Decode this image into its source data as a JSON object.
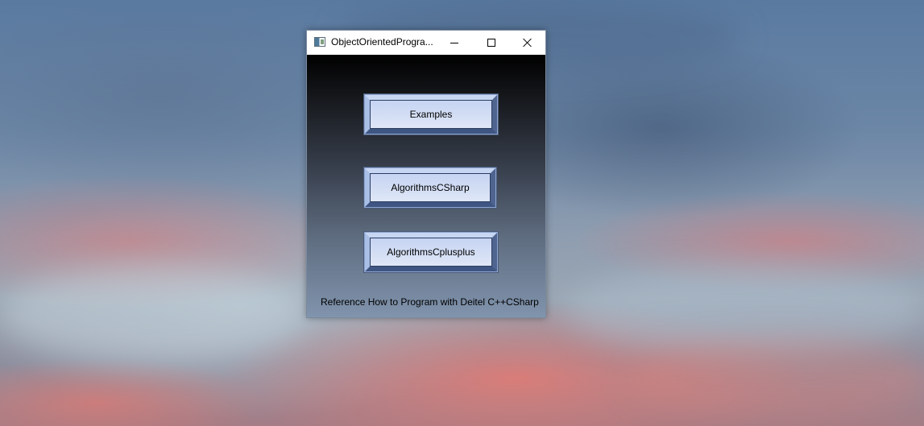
{
  "window": {
    "title": "ObjectOrientedProgra...",
    "icon": "app-window-icon",
    "controls": {
      "minimize": "minimize-icon",
      "maximize": "maximize-icon",
      "close": "close-icon"
    }
  },
  "buttons": {
    "examples": "Examples",
    "algorithms_csharp": "AlgorithmsCSharp",
    "algorithms_cplusplus": "AlgorithmsCplusplus"
  },
  "footer": {
    "text": "Reference How to Program with Deitel C++CSharp"
  },
  "colors": {
    "button_face": "#d2ddf4",
    "button_bevel": "#8ea6d2",
    "client_top": "#000000",
    "client_bottom": "#8194ad"
  }
}
